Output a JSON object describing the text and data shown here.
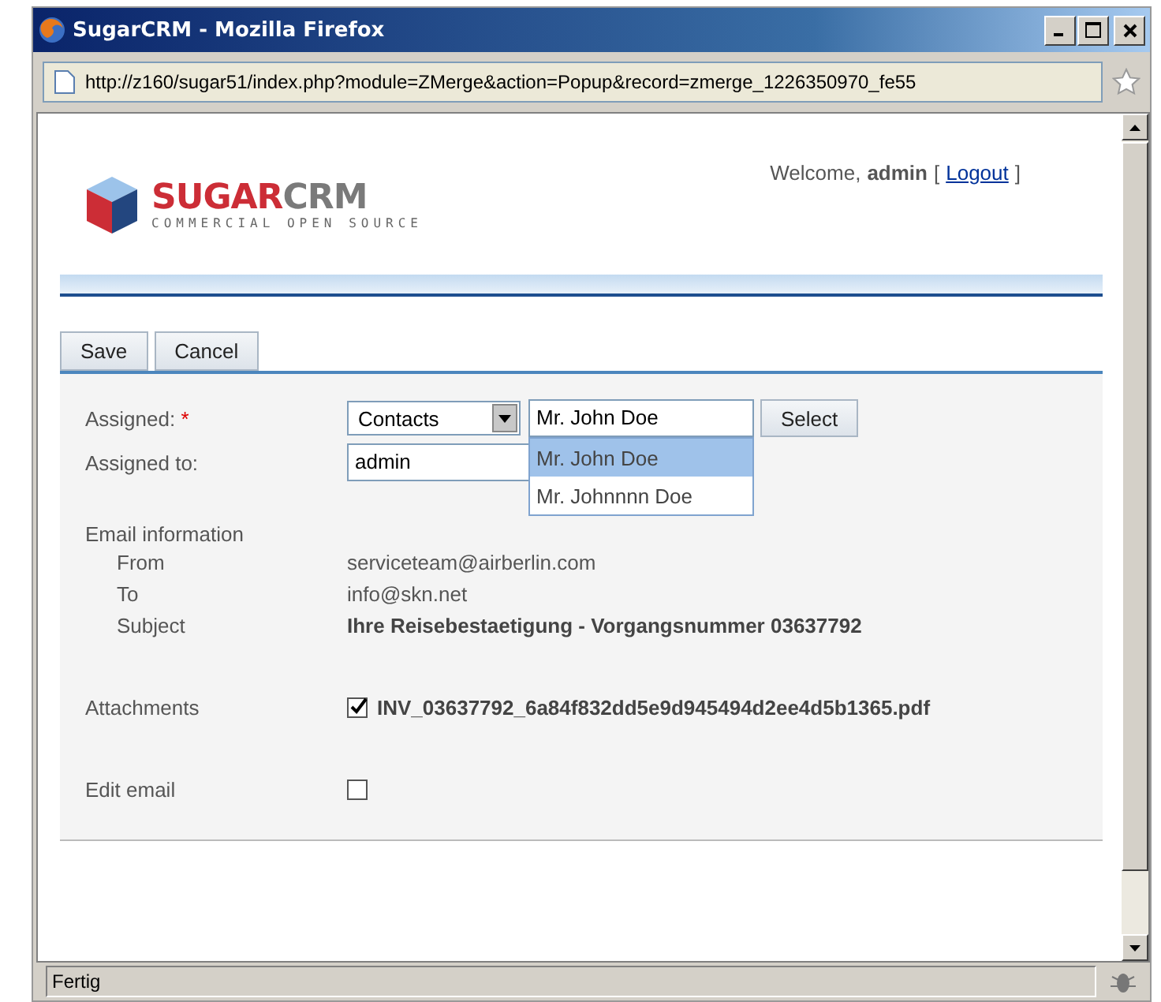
{
  "window": {
    "title": "SugarCRM - Mozilla Firefox",
    "url": "http://z160/sugar51/index.php?module=ZMerge&action=Popup&record=zmerge_1226350970_fe55"
  },
  "header": {
    "logo": {
      "name_first": "SUGAR",
      "name_second": "CRM",
      "tagline": "COMMERCIAL OPEN SOURCE"
    },
    "welcome": "Welcome,",
    "user": "admin",
    "logout_open": "[",
    "logout": "Logout",
    "logout_close": "]"
  },
  "buttons": [
    "Save",
    "Cancel"
  ],
  "form": {
    "assigned": {
      "label": "Assigned:",
      "required_mark": "*",
      "module": "Contacts",
      "value": "Mr. John Doe",
      "select_button": "Select",
      "suggestions": [
        {
          "label": "Mr. John Doe",
          "selected": true
        },
        {
          "label": "Mr. Johnnnn Doe",
          "selected": false
        }
      ]
    },
    "assigned_to": {
      "label": "Assigned to:",
      "value": "admin"
    },
    "email_info": {
      "label": "Email information",
      "rows": [
        {
          "label": "From",
          "value": "serviceteam@airberlin.com",
          "bold": false
        },
        {
          "label": "To",
          "value": "info@skn.net",
          "bold": false
        },
        {
          "label": "Subject",
          "value": "Ihre Reisebestaetigung - Vorgangsnummer 03637792",
          "bold": true
        }
      ]
    },
    "attachments": {
      "label": "Attachments",
      "checked": true,
      "file": "INV_03637792_6a84f832dd5e9d945494d2ee4d5b1365.pdf"
    },
    "edit_email": {
      "label": "Edit email",
      "checked": false
    }
  },
  "status_bar": {
    "text": "Fertig"
  }
}
